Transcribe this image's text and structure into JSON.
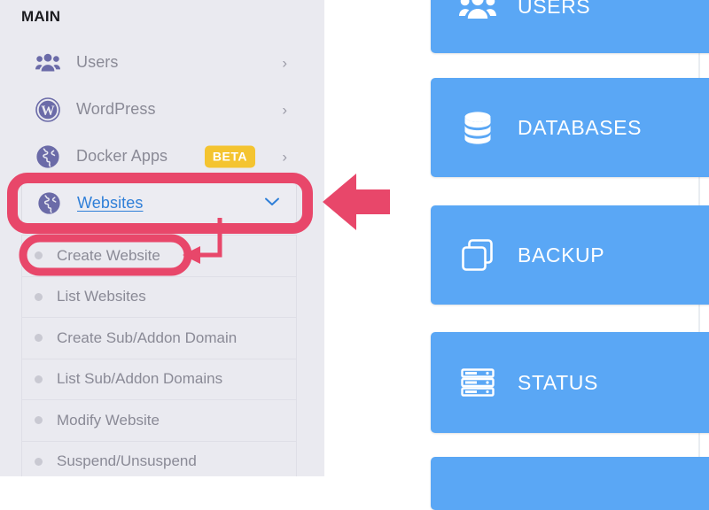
{
  "sidebar": {
    "section_title": "MAIN",
    "items": [
      {
        "label": "Users",
        "icon": "users-group-icon",
        "chevron": "›",
        "badge": null
      },
      {
        "label": "WordPress",
        "icon": "wordpress-icon",
        "chevron": "›",
        "badge": null
      },
      {
        "label": "Docker Apps",
        "icon": "globe-icon",
        "chevron": "›",
        "badge": "BETA"
      }
    ],
    "active_item": {
      "label": "Websites",
      "icon": "globe-icon",
      "chevron": "chevron-down-icon",
      "expanded": true
    },
    "sub_items": [
      {
        "label": "Create Website",
        "bullet": "dot-icon",
        "highlighted": true
      },
      {
        "label": "List Websites",
        "bullet": "dot-icon",
        "highlighted": false
      },
      {
        "label": "Create Sub/Addon Domain",
        "bullet": "dot-icon",
        "highlighted": false
      },
      {
        "label": "List Sub/Addon Domains",
        "bullet": "dot-icon",
        "highlighted": false
      },
      {
        "label": "Modify Website",
        "bullet": "dot-icon",
        "highlighted": false
      },
      {
        "label": "Suspend/Unsuspend",
        "bullet": "dot-icon",
        "highlighted": false
      }
    ]
  },
  "cards": [
    {
      "label": "USERS",
      "icon": "users-group-icon"
    },
    {
      "label": "DATABASES",
      "icon": "database-icon"
    },
    {
      "label": "BACKUP",
      "icon": "copy-documents-icon"
    },
    {
      "label": "STATUS",
      "icon": "server-rack-icon"
    },
    {
      "label": "",
      "icon": ""
    }
  ],
  "annotations": {
    "highlight_box_label": "Websites",
    "highlight_pill_label": "Create Website",
    "arrow_large": "arrow-left-icon",
    "arrow_small": "arrow-left-icon"
  },
  "colors": {
    "annotation_red": "#e8476a",
    "card_blue": "#5aa7f5",
    "link_blue": "#2f7fd8",
    "badge_yellow": "#f4c430",
    "icon_purple": "#6b6ba8",
    "sidebar_bg": "#eaeaf0",
    "muted_text": "#8a8a96"
  }
}
